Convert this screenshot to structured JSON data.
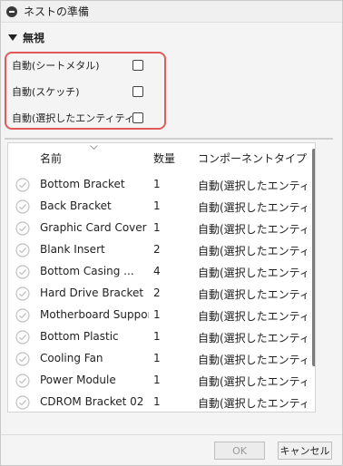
{
  "window": {
    "title": "ネストの準備"
  },
  "section": {
    "title": "無視"
  },
  "options": [
    {
      "label": "自動(シートメタル)",
      "checked": false
    },
    {
      "label": "自動(スケッチ)",
      "checked": false
    },
    {
      "label": "自動(選択したエンティティ)",
      "checked": false
    }
  ],
  "table": {
    "headers": {
      "name": "名前",
      "qty": "数量",
      "type": "コンポーネントタイプ"
    },
    "rows": [
      {
        "name": "Bottom Bracket",
        "qty": "1",
        "type": "自動(選択したエンティ..."
      },
      {
        "name": "Back Bracket",
        "qty": "1",
        "type": "自動(選択したエンティ..."
      },
      {
        "name": "Graphic Card Cover",
        "qty": "1",
        "type": "自動(選択したエンティ..."
      },
      {
        "name": "Blank Insert",
        "qty": "2",
        "type": "自動(選択したエンティ..."
      },
      {
        "name": "Bottom Casing ...",
        "qty": "4",
        "type": "自動(選択したエンティ..."
      },
      {
        "name": "Hard Drive Bracket",
        "qty": "2",
        "type": "自動(選択したエンティ..."
      },
      {
        "name": "Motherboard Support",
        "qty": "1",
        "type": "自動(選択したエンティ..."
      },
      {
        "name": "Bottom Plastic",
        "qty": "1",
        "type": "自動(選択したエンティ..."
      },
      {
        "name": "Cooling Fan",
        "qty": "1",
        "type": "自動(選択したエンティ..."
      },
      {
        "name": "Power Module",
        "qty": "1",
        "type": "自動(選択したエンティ..."
      },
      {
        "name": "CDROM Bracket 02",
        "qty": "1",
        "type": "自動(選択したエンティ..."
      }
    ]
  },
  "buttons": {
    "ok": "OK",
    "cancel": "キャンセル"
  },
  "colors": {
    "highlight": "#e05a5a",
    "accent": "#3a3a3a"
  }
}
